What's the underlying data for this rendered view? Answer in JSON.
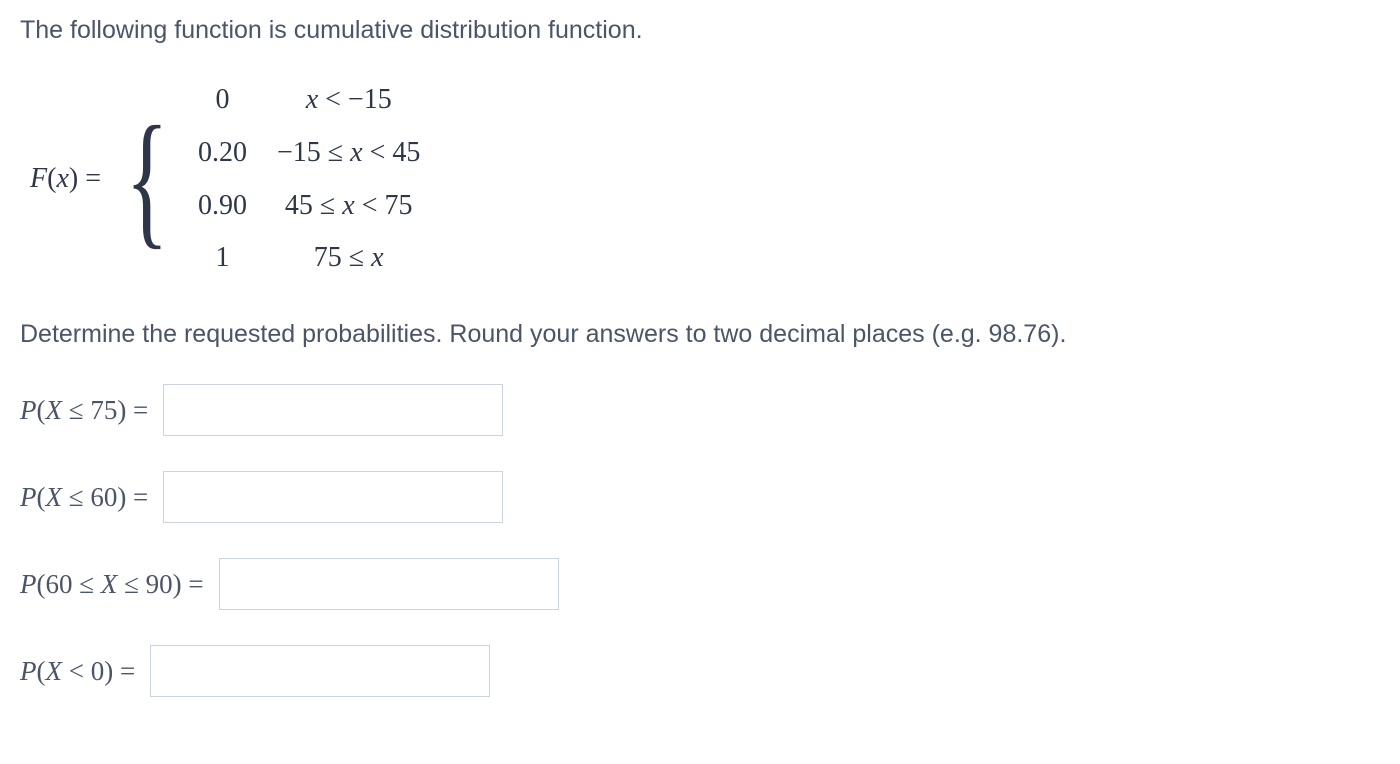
{
  "intro": "The following function is cumulative distribution function.",
  "fx_label": "F(x) =",
  "piecewise": {
    "rows": [
      {
        "value": "0",
        "condition": "x < −15"
      },
      {
        "value": "0.20",
        "condition": "−15 ≤ x < 45"
      },
      {
        "value": "0.90",
        "condition": "45 ≤ x < 75"
      },
      {
        "value": "1",
        "condition": "75 ≤ x"
      }
    ]
  },
  "instruction": "Determine the requested probabilities. Round your answers to two decimal places (e.g. 98.76).",
  "questions": [
    {
      "label": "P(X ≤ 75) =",
      "value": ""
    },
    {
      "label": "P(X ≤ 60) =",
      "value": ""
    },
    {
      "label": "P(60 ≤ X ≤ 90) =",
      "value": ""
    },
    {
      "label": "P(X < 0) =",
      "value": ""
    }
  ]
}
